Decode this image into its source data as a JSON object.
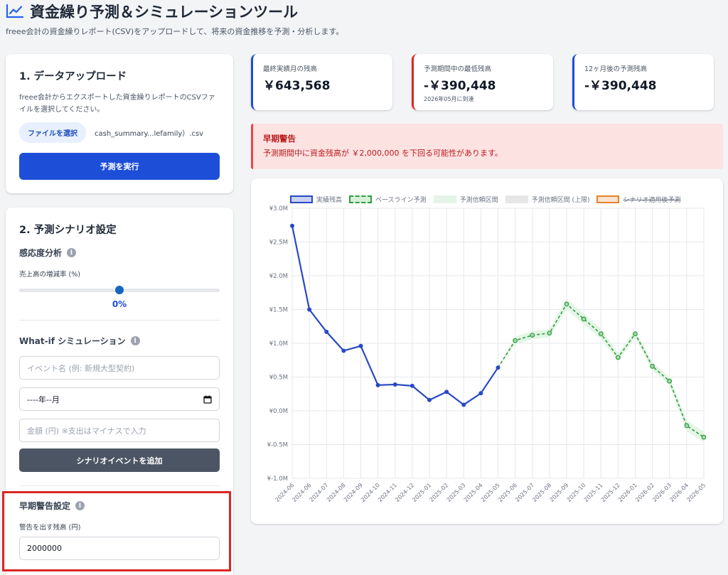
{
  "header": {
    "title": "資金繰り予測＆シミュレーションツール",
    "subtitle": "freee会計の資金繰りレポート(CSV)をアップロードして、将来の資金推移を予測・分析します。"
  },
  "upload": {
    "title": "1. データアップロード",
    "description": "freee会計からエクスポートした資金繰りレポートのCSVファイルを選択してください。",
    "file_button": "ファイルを選択",
    "file_name": "cash_summary...lefamily）.csv",
    "run_button": "予測を実行"
  },
  "scenario": {
    "title": "2. 予測シナリオ設定",
    "sensitivity": {
      "title": "感応度分析",
      "label": "売上高の増減率 (%)",
      "value": 0,
      "value_label": "0%"
    },
    "whatif": {
      "title": "What-if シミュレーション",
      "event_placeholder": "イベント名 (例: 新規大型契約)",
      "month_value": "----年--月",
      "amount_placeholder": "金額 (円) ※支出はマイナスで入力",
      "add_button": "シナリオイベントを追加"
    },
    "warning": {
      "title": "早期警告設定",
      "label": "警告を出す残高 (円)",
      "value": "2000000"
    }
  },
  "stats": [
    {
      "label": "最終実績月の残高",
      "value": "￥643,568",
      "note": "",
      "accent": "#1d4ed8"
    },
    {
      "label": "予測期間中の最低残高",
      "value": "-￥390,448",
      "note": "2026年05月に到達",
      "accent": "#dc2626"
    },
    {
      "label": "12ヶ月後の予測残高",
      "value": "-￥390,448",
      "note": "",
      "accent": "#1d4ed8"
    }
  ],
  "alert": {
    "title": "早期警告",
    "message": "予測期間中に資金残高が ￥2,000,000 を下回る可能性があります。"
  },
  "icons": {
    "title": "chart-line-icon",
    "info": "info-icon",
    "calendar": "calendar-icon"
  },
  "colors": {
    "actual": "#2849c4",
    "baseline": "#2e9e3e",
    "band": "#e4f5e6",
    "band_upper": "#e6e6e6",
    "scenario": "#e8822a",
    "primary": "#1d4ed8",
    "danger": "#dc2626"
  },
  "chart_data": {
    "type": "line",
    "x": [
      "2024-06",
      "2024-06",
      "2024-07",
      "2024-08",
      "2024-09",
      "2024-10",
      "2024-11",
      "2024-12",
      "2025-01",
      "2025-02",
      "2025-03",
      "2025-04",
      "2025-05",
      "2025-06",
      "2025-07",
      "2025-08",
      "2025-09",
      "2025-10",
      "2025-11",
      "2025-12",
      "2026-01",
      "2026-02",
      "2026-03",
      "2026-04",
      "2026-05"
    ],
    "ylim": [
      -1.0,
      3.0
    ],
    "yticks": [
      -1.0,
      -0.5,
      0.0,
      0.5,
      1.0,
      1.5,
      2.0,
      2.5,
      3.0
    ],
    "ytick_labels": [
      "¥-1.0M",
      "¥-0.5M",
      "¥0.0M",
      "¥0.5M",
      "¥1.0M",
      "¥1.5M",
      "¥2.0M",
      "¥2.5M",
      "¥3.0M"
    ],
    "legend": [
      "実績残高",
      "ベースライン予測",
      "予測信頼区間",
      "予測信頼区間 (上限)",
      "シナリオ適用後予測"
    ],
    "grid": true,
    "series": [
      {
        "name": "実績残高",
        "values": [
          2.74,
          1.5,
          1.17,
          0.89,
          0.96,
          0.38,
          0.39,
          0.37,
          0.16,
          0.28,
          0.09,
          0.26,
          0.64,
          null,
          null,
          null,
          null,
          null,
          null,
          null,
          null,
          null,
          null,
          null,
          null
        ]
      },
      {
        "name": "ベースライン予測",
        "values": [
          null,
          null,
          null,
          null,
          null,
          null,
          null,
          null,
          null,
          null,
          null,
          null,
          0.64,
          1.04,
          1.12,
          1.15,
          1.58,
          1.36,
          1.14,
          0.79,
          1.14,
          0.66,
          0.44,
          -0.22,
          -0.39
        ]
      },
      {
        "name": "予測信頼区間",
        "lower": [
          null,
          null,
          null,
          null,
          null,
          null,
          null,
          null,
          null,
          null,
          null,
          null,
          0.64,
          0.98,
          1.06,
          1.09,
          1.5,
          1.28,
          1.06,
          0.73,
          1.08,
          0.6,
          0.38,
          -0.3,
          -0.47
        ],
        "upper": [
          null,
          null,
          null,
          null,
          null,
          null,
          null,
          null,
          null,
          null,
          null,
          null,
          0.64,
          1.1,
          1.18,
          1.21,
          1.66,
          1.44,
          1.22,
          0.85,
          1.2,
          0.72,
          0.5,
          -0.14,
          -0.31
        ]
      }
    ]
  }
}
